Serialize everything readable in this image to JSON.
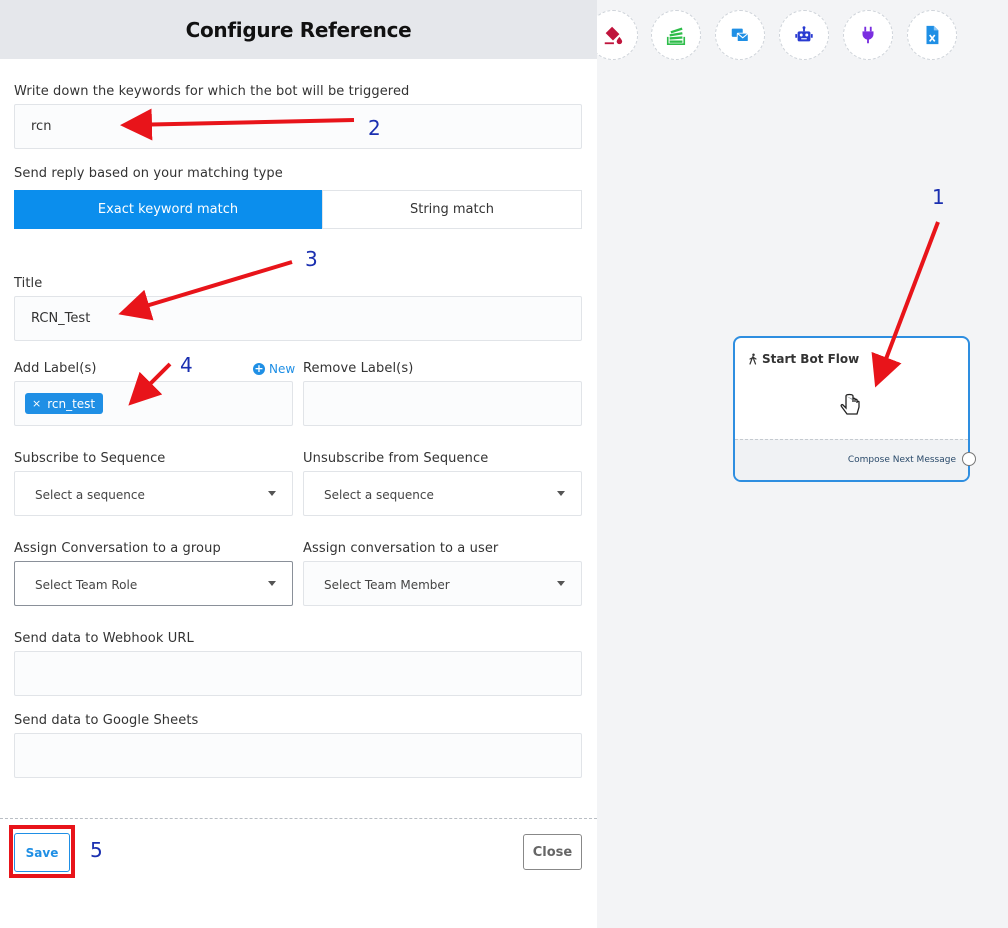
{
  "panel": {
    "title": "Configure Reference",
    "keywords": {
      "label": "Write down the keywords for which the bot will be triggered",
      "value": "rcn"
    },
    "matching": {
      "label": "Send reply based on your matching type",
      "options": [
        "Exact keyword match",
        "String match"
      ],
      "selected": "Exact keyword match"
    },
    "title_field": {
      "label": "Title",
      "value": "RCN_Test"
    },
    "add_labels": {
      "label": "Add Label(s)",
      "new_label": "New",
      "tags": [
        "rcn_test"
      ],
      "tag_remove": "×"
    },
    "remove_labels": {
      "label": "Remove Label(s)"
    },
    "subscribe": {
      "label": "Subscribe to Sequence",
      "value": "Select a sequence"
    },
    "unsubscribe": {
      "label": "Unsubscribe from Sequence",
      "value": "Select a sequence"
    },
    "assign_group": {
      "label": "Assign Conversation to a group",
      "value": "Select Team Role"
    },
    "assign_user": {
      "label": "Assign conversation to a user",
      "value": "Select Team Member"
    },
    "webhook": {
      "label": "Send data to Webhook URL",
      "value": ""
    },
    "google_sheets": {
      "label": "Send data to Google Sheets",
      "value": ""
    },
    "save_label": "Save",
    "close_label": "Close"
  },
  "toolbar": {
    "icons": [
      "paint-bucket-icon",
      "stack-icon",
      "email-sms-icon",
      "robot-icon",
      "plug-icon",
      "excel-file-icon"
    ],
    "colors": [
      "#c0143c",
      "#2ebd4a",
      "#1f8fe5",
      "#2a3bd1",
      "#7a2ee0",
      "#1f8fe5"
    ]
  },
  "node": {
    "title": "Start Bot Flow",
    "footer": "Compose Next Message"
  },
  "annotations": [
    "1",
    "2",
    "3",
    "4",
    "5"
  ],
  "colors": {
    "primary": "#0b8eed",
    "annotation_arrow": "#e8141a",
    "annotation_number": "#1a2fb0"
  }
}
